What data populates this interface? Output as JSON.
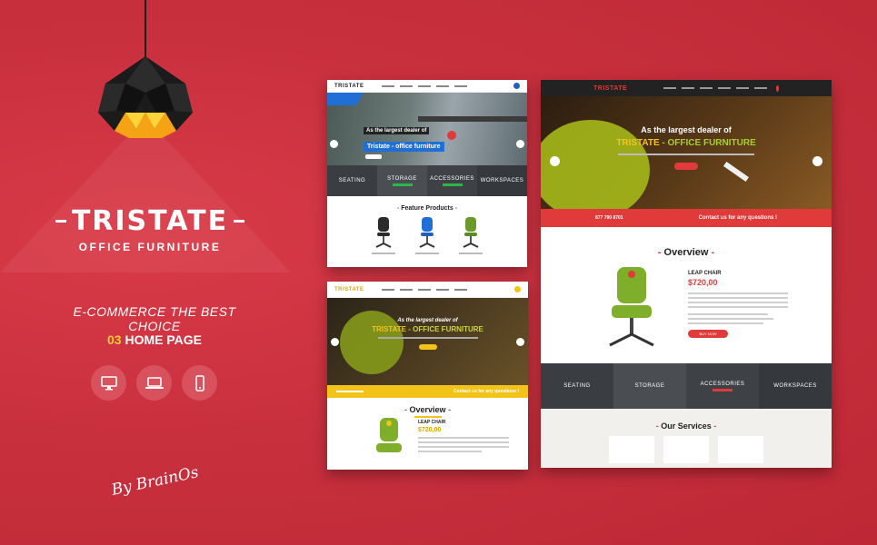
{
  "brand": {
    "title": "TRISTATE",
    "subtitle": "OFFICE FURNITURE",
    "tagline": "E-COMMERCE THE BEST CHOICE",
    "homepage_count": "03",
    "homepage_label": "HOME PAGE",
    "signature": "By BrainOs"
  },
  "devices": [
    {
      "icon": "desktop-icon"
    },
    {
      "icon": "laptop-icon"
    },
    {
      "icon": "mobile-icon"
    }
  ],
  "home1": {
    "logo": "TRISTATE",
    "hero_line1": "As the largest dealer of",
    "hero_line2": "Tristate - office furniture",
    "categories": [
      "SEATING",
      "STORAGE",
      "ACCESSORIES",
      "WORKSPACES"
    ],
    "section_title": "Feature Products"
  },
  "home2": {
    "logo": "TRISTATE",
    "hero_line1": "As the largest dealer of",
    "hero_line2": "TRISTATE",
    "hero_line3": "- OFFICE FURNITURE",
    "contact_text": "Contact us for any questions !",
    "section_title": "Overview",
    "product_name": "LEAP CHAIR",
    "price": "$720,00"
  },
  "home3": {
    "logo": "TRISTATE",
    "hero_line1": "As the largest dealer of",
    "hero_line2": "TRISTATE",
    "hero_line3": "- OFFICE FURNITURE",
    "phone": "877 790 8701",
    "contact_text": "Contact us for any questions !",
    "section_title": "Overview",
    "product_name": "LEAP CHAIR",
    "price": "$720,00",
    "buy_label": "BUY NOW",
    "categories": [
      "SEATING",
      "STORAGE",
      "ACCESSORIES",
      "WORKSPACES"
    ],
    "services_title": "Our Services"
  },
  "colors": {
    "background": "#c9303e",
    "accent_yellow": "#ffcc33",
    "green": "#2db84b",
    "red": "#e03a3a",
    "blue": "#1f5fbf"
  }
}
